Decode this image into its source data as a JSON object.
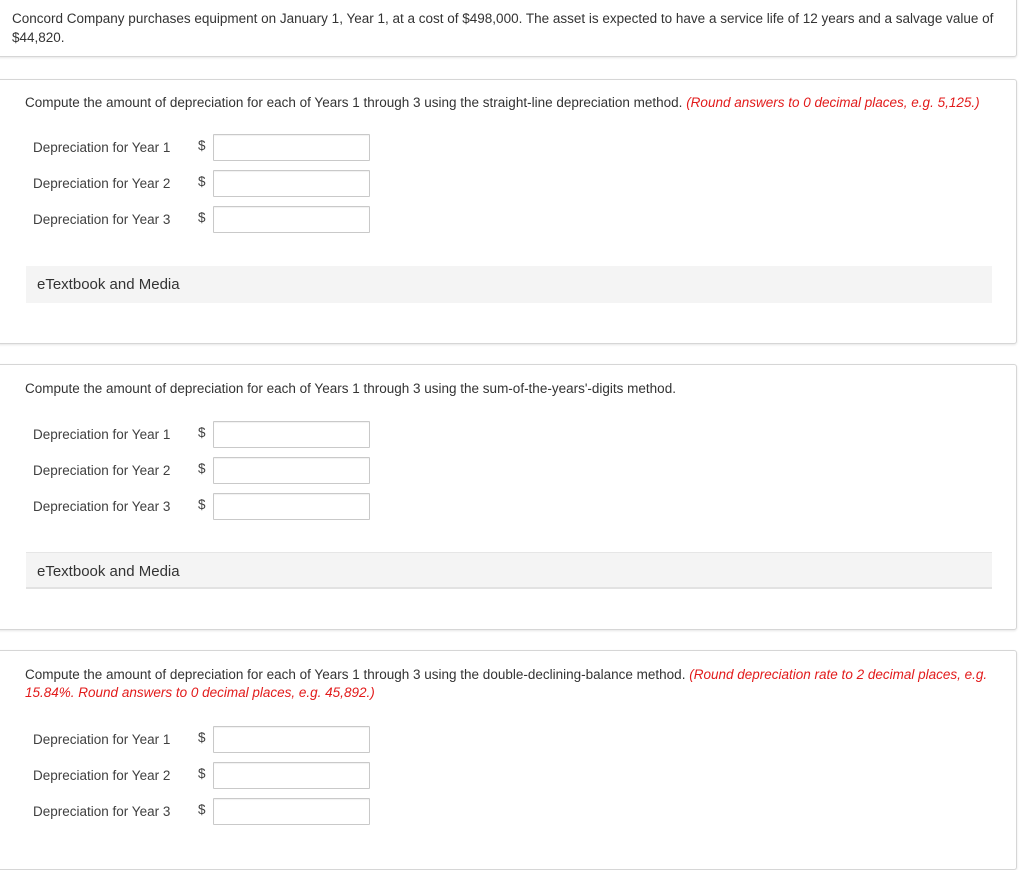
{
  "problem": {
    "statement": "Concord Company purchases equipment on January 1, Year 1, at a cost of $498,000. The asset is expected to have a service life of 12 years and a salvage value of $44,820."
  },
  "parts": [
    {
      "prompt": "Compute the amount of depreciation for each of Years 1 through 3 using the straight-line depreciation method.",
      "hint": "(Round answers to 0 decimal places, e.g. 5,125.)",
      "rows": [
        {
          "label": "Depreciation for Year 1",
          "currency": "$",
          "value": ""
        },
        {
          "label": "Depreciation for Year 2",
          "currency": "$",
          "value": ""
        },
        {
          "label": "Depreciation for Year 3",
          "currency": "$",
          "value": ""
        }
      ],
      "etextbook_label": "eTextbook and Media"
    },
    {
      "prompt": "Compute the amount of depreciation for each of Years 1 through 3 using the sum-of-the-years'-digits method.",
      "hint": "",
      "rows": [
        {
          "label": "Depreciation for Year 1",
          "currency": "$",
          "value": ""
        },
        {
          "label": "Depreciation for Year 2",
          "currency": "$",
          "value": ""
        },
        {
          "label": "Depreciation for Year 3",
          "currency": "$",
          "value": ""
        }
      ],
      "etextbook_label": "eTextbook and Media"
    },
    {
      "prompt": "Compute the amount of depreciation for each of Years 1 through 3 using the double-declining-balance method.",
      "hint": "(Round depreciation rate to 2 decimal places, e.g. 15.84%. Round answers to 0 decimal places, e.g. 45,892.)",
      "rows": [
        {
          "label": "Depreciation for Year 1",
          "currency": "$",
          "value": ""
        },
        {
          "label": "Depreciation for Year 2",
          "currency": "$",
          "value": ""
        },
        {
          "label": "Depreciation for Year 3",
          "currency": "$",
          "value": ""
        }
      ]
    }
  ],
  "colors": {
    "hint": "#e21b1b",
    "etextbook_bg": "#f4f4f4",
    "panel_border": "#d6d6d6"
  }
}
